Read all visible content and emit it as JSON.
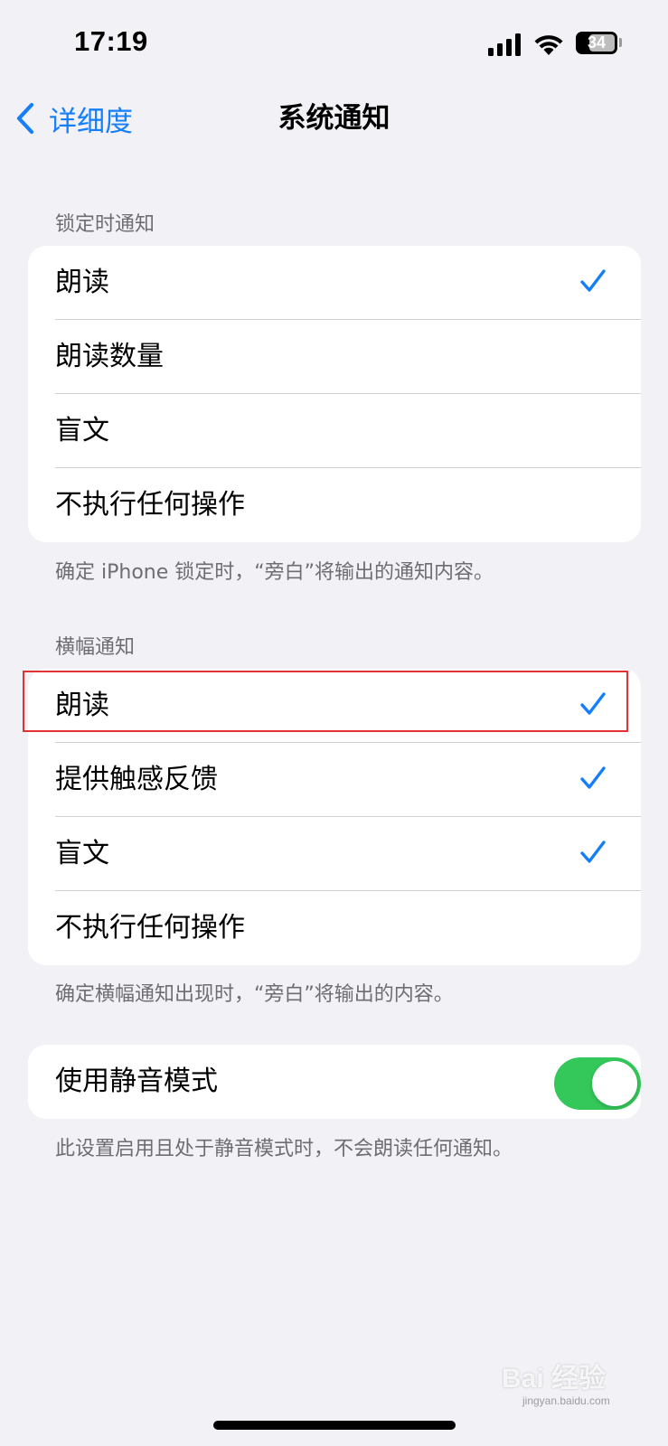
{
  "status_bar": {
    "time": "17:19",
    "battery": "34"
  },
  "nav": {
    "back_label": "详细度",
    "title": "系统通知"
  },
  "lock_section": {
    "header": "锁定时通知",
    "items": [
      {
        "label": "朗读",
        "checked": true
      },
      {
        "label": "朗读数量",
        "checked": false
      },
      {
        "label": "盲文",
        "checked": false
      },
      {
        "label": "不执行任何操作",
        "checked": false
      }
    ],
    "footer": "确定 iPhone 锁定时，“旁白”将输出的通知内容。"
  },
  "banner_section": {
    "header": "横幅通知",
    "items": [
      {
        "label": "朗读",
        "checked": true
      },
      {
        "label": "提供触感反馈",
        "checked": true
      },
      {
        "label": "盲文",
        "checked": true
      },
      {
        "label": "不执行任何操作",
        "checked": false
      }
    ],
    "footer": "确定横幅通知出现时，“旁白”将输出的内容。"
  },
  "silent_section": {
    "label": "使用静音模式",
    "enabled": true,
    "footer": "此设置启用且处于静音模式时，不会朗读任何通知。"
  },
  "watermark": {
    "text": "Bai 经验",
    "sub": "jingyan.baidu.com"
  },
  "colors": {
    "accent": "#147efb",
    "toggle_on": "#34c759",
    "highlight": "#e13236",
    "background": "#f2f1f6"
  }
}
